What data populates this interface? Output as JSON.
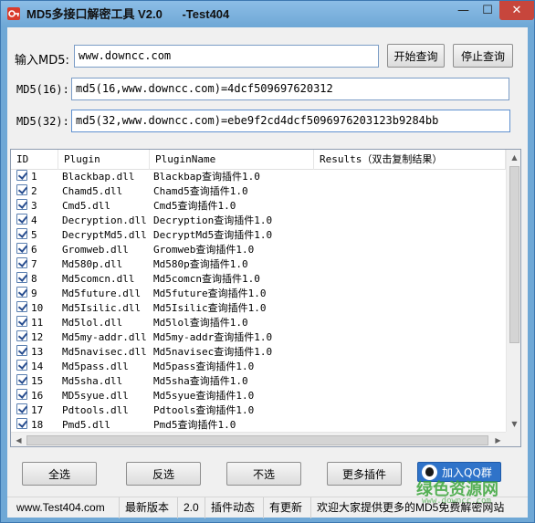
{
  "window": {
    "title": "MD5多接口解密工具 V2.0      -Test404",
    "minimize": "—",
    "maximize": "☐",
    "close": "✕"
  },
  "query": {
    "input_label": "输入MD5:",
    "input_value": "www.downcc.com",
    "start_button": "开始查询",
    "stop_button": "停止查询",
    "md5_16_label": "MD5(16):",
    "md5_16_value": "md5(16,www.downcc.com)=4dcf509697620312",
    "md5_32_label": "MD5(32):",
    "md5_32_value": "md5(32,www.downcc.com)=ebe9f2cd4dcf5096976203123b9284bb"
  },
  "table": {
    "columns": [
      "ID",
      "Plugin",
      "PluginName",
      "Results（双击复制结果）"
    ],
    "rows": [
      {
        "id": "1",
        "plugin": "Blackbap.dll",
        "name": "Blackbap查询插件1.0"
      },
      {
        "id": "2",
        "plugin": "Chamd5.dll",
        "name": "Chamd5查询插件1.0"
      },
      {
        "id": "3",
        "plugin": "Cmd5.dll",
        "name": "Cmd5查询插件1.0"
      },
      {
        "id": "4",
        "plugin": "Decryption.dll",
        "name": "Decryption查询插件1.0"
      },
      {
        "id": "5",
        "plugin": "DecryptMd5.dll",
        "name": "DecryptMd5查询插件1.0"
      },
      {
        "id": "6",
        "plugin": "Gromweb.dll",
        "name": "Gromweb查询插件1.0"
      },
      {
        "id": "7",
        "plugin": "Md580p.dll",
        "name": "Md580p查询插件1.0"
      },
      {
        "id": "8",
        "plugin": "Md5comcn.dll",
        "name": "Md5comcn查询插件1.0"
      },
      {
        "id": "9",
        "plugin": "Md5future.dll",
        "name": "Md5future查询插件1.0"
      },
      {
        "id": "10",
        "plugin": "Md5Isilic.dll",
        "name": "Md5Isilic查询插件1.0"
      },
      {
        "id": "11",
        "plugin": "Md5lol.dll",
        "name": "Md5lol查询插件1.0"
      },
      {
        "id": "12",
        "plugin": "Md5my-addr.dll",
        "name": "Md5my-addr查询插件1.0"
      },
      {
        "id": "13",
        "plugin": "Md5navisec.dll",
        "name": "Md5navisec查询插件1.0"
      },
      {
        "id": "14",
        "plugin": "Md5pass.dll",
        "name": "Md5pass查询插件1.0"
      },
      {
        "id": "15",
        "plugin": "Md5sha.dll",
        "name": "Md5sha查询插件1.0"
      },
      {
        "id": "16",
        "plugin": "MD5syue.dll",
        "name": "Md5syue查询插件1.0"
      },
      {
        "id": "17",
        "plugin": "Pdtools.dll",
        "name": "Pdtools查询插件1.0"
      },
      {
        "id": "18",
        "plugin": "Pmd5.dll",
        "name": "Pmd5查询插件1.0"
      }
    ]
  },
  "actions": {
    "select_all": "全选",
    "invert": "反选",
    "deselect": "不选",
    "more_plugins": "更多插件",
    "join_qq": "加入QQ群"
  },
  "status": {
    "site": "www.Test404.com",
    "latest_label": "最新版本",
    "version": "2.0",
    "plugin_news_label": "插件动态",
    "plugin_news_value": "有更新",
    "welcome": "欢迎大家提供更多的MD5免费解密网站"
  },
  "watermark": {
    "text": "绿色资源网",
    "url": "www.downcc.com"
  },
  "colors": {
    "frame": "#6fa8d6",
    "close": "#c7463c",
    "qq_button": "#2f73c9",
    "watermark": "#3aa53a"
  },
  "icons": {
    "app": "key-shield-icon",
    "qq": "qq-penguin-icon"
  }
}
